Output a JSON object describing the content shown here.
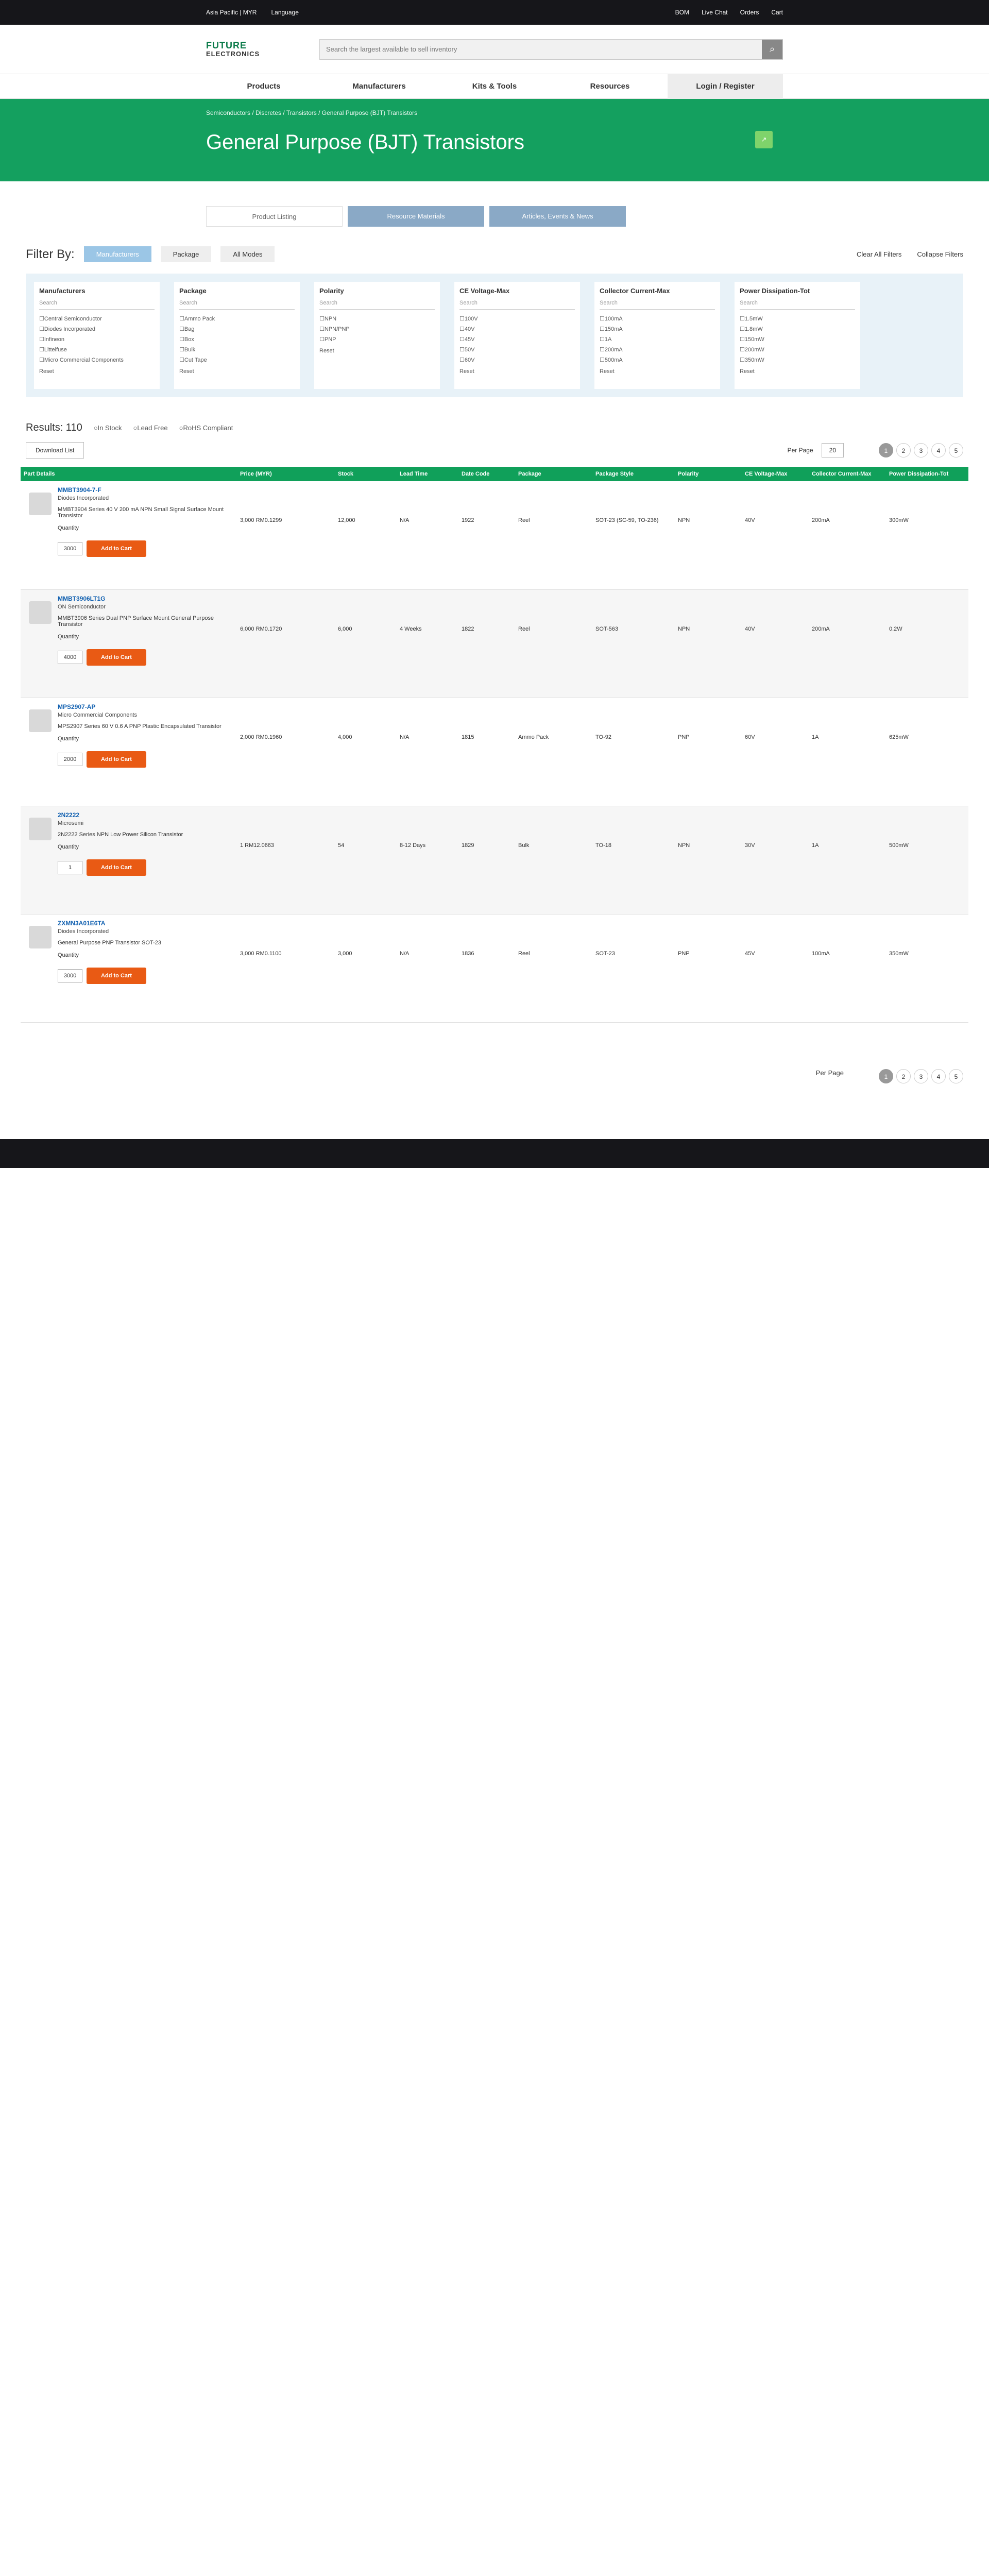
{
  "topbar": {
    "region": "Asia Pacific | MYR",
    "language": "Language",
    "util": [
      "BOM",
      "Live Chat",
      "Orders",
      "Cart"
    ]
  },
  "header": {
    "logo": "FUTURE",
    "logo_sub": "ELECTRONICS",
    "search_placeholder": "Search the largest available to sell inventory"
  },
  "nav": [
    "Products",
    "Manufacturers",
    "Kits & Tools",
    "Resources",
    "Login / Register"
  ],
  "hero": {
    "breadcrumb": "Semiconductors / Discretes / Transistors / General Purpose (BJT) Transistors",
    "title": "General Purpose (BJT) Transistors"
  },
  "tabs": [
    "Product Listing",
    "Resource Materials",
    "Articles, Events & News"
  ],
  "filter": {
    "label": "Filter By:",
    "pills": [
      "Manufacturers",
      "Package",
      "All Modes"
    ],
    "clear": "Clear All Filters",
    "collapse": "Collapse Filters"
  },
  "facets": [
    {
      "title": "Manufacturers",
      "options": [
        "Central Semiconductor",
        "Diodes Incorporated",
        "Infineon",
        "Littelfuse",
        "Micro Commercial Components"
      ]
    },
    {
      "title": "Package",
      "options": [
        "Ammo Pack",
        "Bag",
        "Box",
        "Bulk",
        "Cut Tape"
      ]
    },
    {
      "title": "Polarity",
      "options": [
        "NPN",
        "NPN/PNP",
        "PNP"
      ]
    },
    {
      "title": "CE Voltage-Max",
      "options": [
        "100V",
        "40V",
        "45V",
        "50V",
        "60V"
      ]
    },
    {
      "title": "Collector Current-Max",
      "options": [
        "100mA",
        "150mA",
        "1A",
        "200mA",
        "500mA"
      ]
    },
    {
      "title": "Power Dissipation-Tot",
      "options": [
        "1.5mW",
        "1.8mW",
        "150mW",
        "200mW",
        "350mW"
      ]
    }
  ],
  "reset": "Reset",
  "results": {
    "text": "Results: 110",
    "in_stock": "In Stock",
    "lead_free": "Lead Free",
    "rohs": "RoHS Compliant"
  },
  "controls": {
    "download": "Download List",
    "per_page": "Per Page",
    "per_page_value": "20",
    "pages": [
      "1",
      "2",
      "3",
      "4",
      "5"
    ]
  },
  "headers": [
    "Part Details",
    "Price (MYR)",
    "Stock",
    "Lead Time",
    "Date Code",
    "Package",
    "Package Style",
    "Polarity",
    "CE Voltage-Max",
    "Collector Current-Max",
    "Power Dissipation-Tot"
  ],
  "rows": [
    {
      "pn": "MMBT3904-7-F",
      "mfr": "Diodes Incorporated",
      "desc": "MMBT3904 Series 40 V 200 mA NPN Small Signal Surface Mount Transistor",
      "price": "3,000 RM0.1299",
      "stock": "12,000",
      "lead": "N/A",
      "dc": "1922",
      "pkg": "Reel",
      "style": "SOT-23 (SC-59, TO-236)",
      "pol": "NPN",
      "v": "40V",
      "i": "200mA",
      "p": "300mW",
      "qty": "3000"
    },
    {
      "pn": "MMBT3906LT1G",
      "mfr": "ON Semiconductor",
      "desc": "MMBT3906 Series Dual PNP Surface Mount General Purpose Transistor",
      "price": "6,000 RM0.1720",
      "stock": "6,000",
      "lead": "4 Weeks",
      "dc": "1822",
      "pkg": "Reel",
      "style": "SOT-563",
      "pol": "NPN",
      "v": "40V",
      "i": "200mA",
      "p": "0.2W",
      "qty": "4000"
    },
    {
      "pn": "MPS2907-AP",
      "mfr": "Micro Commercial Components",
      "desc": "MPS2907 Series 60 V 0.6 A PNP Plastic Encapsulated Transistor",
      "price": "2,000 RM0.1960",
      "stock": "4,000",
      "lead": "N/A",
      "dc": "1815",
      "pkg": "Ammo Pack",
      "style": "TO-92",
      "pol": "PNP",
      "v": "60V",
      "i": "1A",
      "p": "625mW",
      "qty": "2000"
    },
    {
      "pn": "2N2222",
      "mfr": "Microsemi",
      "desc": "2N2222 Series NPN Low Power Silicon Transistor",
      "price": "1 RM12.0663",
      "stock": "54",
      "lead": "8-12 Days",
      "dc": "1829",
      "pkg": "Bulk",
      "style": "TO-18",
      "pol": "NPN",
      "v": "30V",
      "i": "1A",
      "p": "500mW",
      "qty": "1"
    },
    {
      "pn": "ZXMN3A01E6TA",
      "mfr": "Diodes Incorporated",
      "desc": "General Purpose PNP Transistor SOT-23",
      "price": "3,000 RM0.1100",
      "stock": "3,000",
      "lead": "N/A",
      "dc": "1836",
      "pkg": "Reel",
      "style": "SOT-23",
      "pol": "PNP",
      "v": "45V",
      "i": "100mA",
      "p": "350mW",
      "qty": "3000"
    }
  ],
  "add_label": "Add to Cart",
  "qty_label": "Quantity"
}
